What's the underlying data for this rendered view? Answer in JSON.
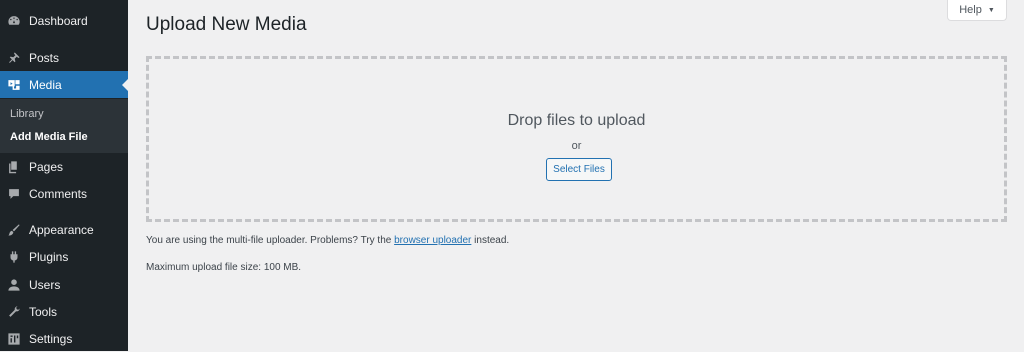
{
  "sidebar": {
    "items": [
      {
        "label": "Dashboard",
        "icon": "dashboard-icon"
      },
      {
        "label": "Posts",
        "icon": "pushpin-icon"
      },
      {
        "label": "Media",
        "icon": "media-icon"
      },
      {
        "label": "Pages",
        "icon": "pages-icon"
      },
      {
        "label": "Comments",
        "icon": "comment-icon"
      },
      {
        "label": "Appearance",
        "icon": "brush-icon"
      },
      {
        "label": "Plugins",
        "icon": "plugin-icon"
      },
      {
        "label": "Users",
        "icon": "user-icon"
      },
      {
        "label": "Tools",
        "icon": "wrench-icon"
      },
      {
        "label": "Settings",
        "icon": "settings-icon"
      }
    ],
    "submenu": [
      {
        "label": "Library"
      },
      {
        "label": "Add Media File"
      }
    ]
  },
  "header": {
    "title": "Upload New Media",
    "help_label": "Help"
  },
  "uploader": {
    "drop_title": "Drop files to upload",
    "or_text": "or",
    "select_button": "Select Files",
    "info_prefix": "You are using the multi-file uploader. Problems? Try the",
    "info_link": "browser uploader",
    "info_suffix": "instead.",
    "max_size": "Maximum upload file size: 100 MB."
  },
  "colors": {
    "sidebar_bg": "#1d2327",
    "accent": "#2271b1",
    "page_bg": "#f0f0f1"
  }
}
